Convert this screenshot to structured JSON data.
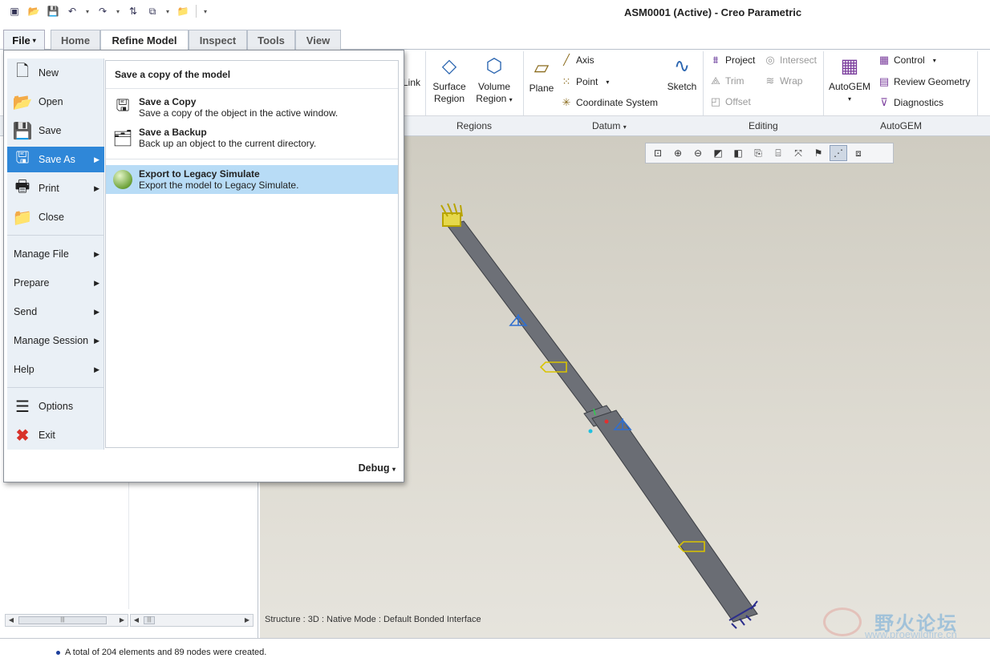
{
  "window": {
    "title": "ASM0001 (Active) - Creo Parametric"
  },
  "tabs": [
    {
      "label": "File"
    },
    {
      "label": "Home"
    },
    {
      "label": "Refine Model"
    },
    {
      "label": "Inspect"
    },
    {
      "label": "Tools"
    },
    {
      "label": "View"
    }
  ],
  "ribbon": {
    "link_label": "Link",
    "surface_region": [
      "Surface",
      "Region"
    ],
    "volume_region": [
      "Volume",
      "Region"
    ],
    "plane": "Plane",
    "axis": "Axis",
    "point": "Point",
    "coordinate_system": "Coordinate System",
    "sketch": "Sketch",
    "project": "Project",
    "intersect": "Intersect",
    "trim": "Trim",
    "wrap": "Wrap",
    "offset": "Offset",
    "autogem": "AutoGEM",
    "control": "Control",
    "review_geometry": "Review Geometry",
    "diagnostics": "Diagnostics",
    "groups": {
      "regions": "Regions",
      "datum": "Datum",
      "editing": "Editing",
      "autogem": "AutoGEM"
    }
  },
  "file_menu": {
    "items": [
      {
        "label": "New"
      },
      {
        "label": "Open"
      },
      {
        "label": "Save"
      },
      {
        "label": "Save As"
      },
      {
        "label": "Print"
      },
      {
        "label": "Close"
      },
      {
        "label": "Manage File"
      },
      {
        "label": "Prepare"
      },
      {
        "label": "Send"
      },
      {
        "label": "Manage Session"
      },
      {
        "label": "Help"
      },
      {
        "label": "Options"
      },
      {
        "label": "Exit"
      }
    ],
    "submenu": {
      "title": "Save a copy of the model",
      "items": [
        {
          "title": "Save a Copy",
          "desc": "Save a copy of the object in the active window."
        },
        {
          "title": "Save a Backup",
          "desc": "Back up an object to the current directory."
        },
        {
          "title": "Export to Legacy Simulate",
          "desc": "Export the model to Legacy Simulate."
        }
      ]
    },
    "debug": "Debug"
  },
  "viewport": {
    "status": "Structure : 3D : Native Mode : Default Bonded Interface"
  },
  "watermark": {
    "name": "野火论坛",
    "url": "www.proewildfire.cn"
  },
  "message": {
    "text": "A total of 204 elements and 89 nodes were created."
  }
}
